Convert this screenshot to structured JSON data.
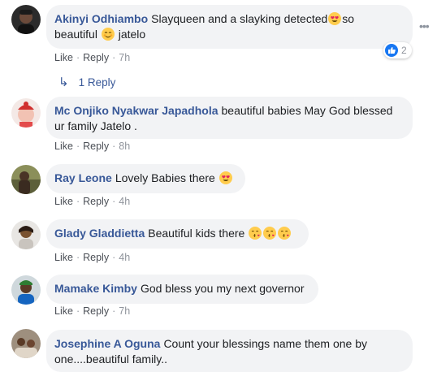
{
  "comments": [
    {
      "author": "Akinyi Odhiambo",
      "text_a": "Slayqueen and a slayking detected",
      "text_b": "so",
      "text_c": "beautiful",
      "text_d": "jatelo",
      "actions": {
        "like": "Like",
        "reply": "Reply",
        "time": "7h"
      },
      "reaction_count": "2",
      "reply_summary": "1 Reply"
    },
    {
      "author": "Mc Onjiko Nyakwar Japadhola",
      "text_a": "beautiful babies May God blessed",
      "text_b": "ur family Jatelo .",
      "actions": {
        "like": "Like",
        "reply": "Reply",
        "time": "8h"
      }
    },
    {
      "author": "Ray Leone",
      "text_a": "Lovely Babies there",
      "actions": {
        "like": "Like",
        "reply": "Reply",
        "time": "4h"
      }
    },
    {
      "author": "Glady Gladdietta",
      "text_a": "Beautiful kids there",
      "actions": {
        "like": "Like",
        "reply": "Reply",
        "time": "4h"
      }
    },
    {
      "author": "Mamake Kimby",
      "text_a": "God bless you my next governor",
      "actions": {
        "like": "Like",
        "reply": "Reply",
        "time": "7h"
      }
    },
    {
      "author": "Josephine A Oguna",
      "text_a": "Count your blessings name them one by",
      "text_b": "one....beautiful family.."
    }
  ],
  "icons": {
    "heart_eyes": "heart-eyes-emoji",
    "smiling": "smiling-face-emoji",
    "kissing": "kissing-heart-emoji",
    "like": "like-thumb-icon",
    "reply_arrow": "reply-arrow-icon",
    "more": "more-options-icon"
  },
  "colors": {
    "author": "#385898",
    "bubble": "#f2f3f5",
    "like_blue": "#1877f2",
    "emoji_yellow": "#ffcc4d"
  }
}
